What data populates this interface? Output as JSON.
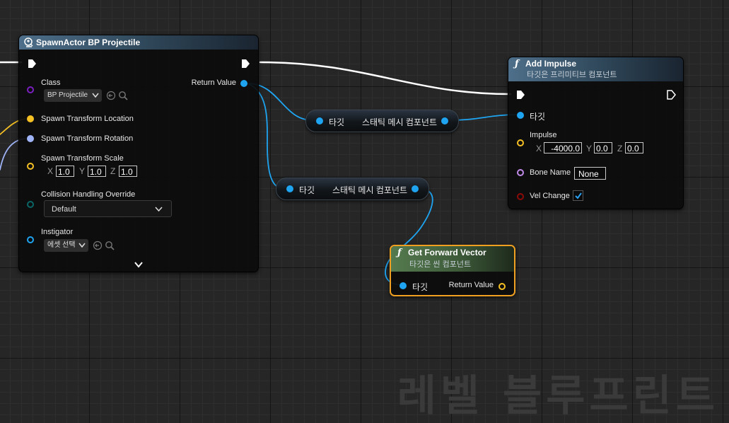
{
  "spawn_node": {
    "title": "SpawnActor BP Projectile",
    "class_label": "Class",
    "class_value": "BP Projectile",
    "return_value_label": "Return Value",
    "location_label": "Spawn Transform Location",
    "rotation_label": "Spawn Transform Rotation",
    "scale_label": "Spawn Transform Scale",
    "scale_x": "1.0",
    "scale_y": "1.0",
    "scale_z": "1.0",
    "collision_label": "Collision Handling Override",
    "collision_value": "Default",
    "instigator_label": "Instigator",
    "instigator_value": "에셋 선택"
  },
  "axis": {
    "x": "X",
    "y": "Y",
    "z": "Z"
  },
  "reroute_1": {
    "target_label": "타깃",
    "component_label": "스태틱 메시 컴포넌트"
  },
  "reroute_2": {
    "target_label": "타깃",
    "component_label": "스태틱 메시 컴포넌트"
  },
  "impulse_node": {
    "title": "Add Impulse",
    "subtitle": "타깃은 프리미티브 컴포넌트",
    "target_label": "타깃",
    "impulse_label": "Impulse",
    "impulse_x": "-4000.0",
    "impulse_y": "0.0",
    "impulse_z": "0.0",
    "bone_name_label": "Bone Name",
    "bone_name_value": "None",
    "vel_change_label": "Vel Change",
    "vel_change_checked": true
  },
  "forward_node": {
    "title": "Get Forward Vector",
    "subtitle": "타깃은 씬 컴포넌트",
    "target_label": "타깃",
    "return_value_label": "Return Value"
  },
  "watermark": "레벨 블루프린트",
  "colors": {
    "exec": "#ffffff",
    "object_pin": "#1ea4f0",
    "vector_pin": "#f5c024",
    "rotator_pin": "#a0b4f8",
    "class_pin": "#7a1fc0",
    "enum_pin": "#0a6666",
    "name_pin": "#c08ae8",
    "bool_pin": "#8c0a0a",
    "function_header": "#3d5a75",
    "pure_function_header": "#4a6a45",
    "selection": "#f0a020"
  }
}
